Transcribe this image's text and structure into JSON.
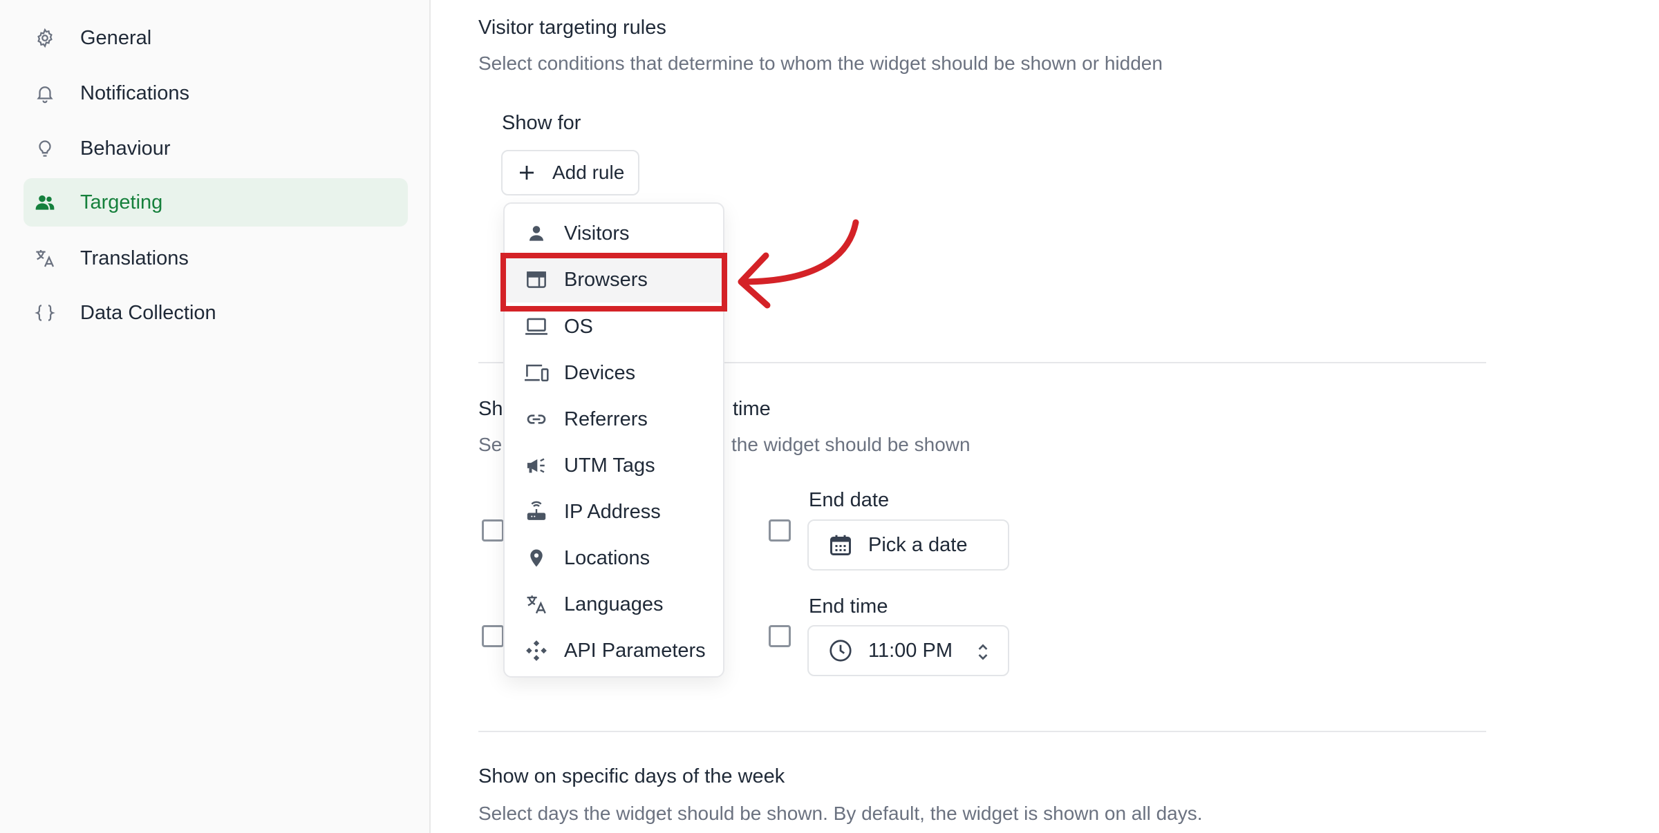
{
  "sidebar": {
    "items": [
      {
        "label": "General",
        "icon": "gear-icon"
      },
      {
        "label": "Notifications",
        "icon": "bell-icon"
      },
      {
        "label": "Behaviour",
        "icon": "lightbulb-icon"
      },
      {
        "label": "Targeting",
        "icon": "users-icon",
        "active": true
      },
      {
        "label": "Translations",
        "icon": "translate-icon"
      },
      {
        "label": "Data Collection",
        "icon": "braces-icon"
      }
    ]
  },
  "visitor_targeting": {
    "title": "Visitor targeting rules",
    "description": "Select conditions that determine to whom the widget should be shown or hidden",
    "show_for_label": "Show for",
    "add_rule_label": "Add rule"
  },
  "rule_menu": {
    "items": [
      {
        "label": "Visitors",
        "icon": "person-icon"
      },
      {
        "label": "Browsers",
        "icon": "browser-window-icon",
        "highlighted": true
      },
      {
        "label": "OS",
        "icon": "laptop-icon"
      },
      {
        "label": "Devices",
        "icon": "devices-icon"
      },
      {
        "label": "Referrers",
        "icon": "link-icon"
      },
      {
        "label": "UTM Tags",
        "icon": "megaphone-icon"
      },
      {
        "label": "IP Address",
        "icon": "router-icon"
      },
      {
        "label": "Locations",
        "icon": "location-pin-icon"
      },
      {
        "label": "Languages",
        "icon": "translate-icon"
      },
      {
        "label": "API Parameters",
        "icon": "api-icon"
      }
    ]
  },
  "schedule": {
    "title_visible_prefix": "Sh",
    "title_visible_suffix": "time",
    "desc_visible_prefix": "Se",
    "desc_visible_suffix": "the widget should be shown",
    "end_date_label": "End date",
    "end_date_placeholder": "Pick a date",
    "end_time_label": "End time",
    "end_time_value": "11:00 PM"
  },
  "days_of_week": {
    "title": "Show on specific days of the week",
    "description": "Select days the widget should be shown. By default, the widget is shown on all days."
  },
  "colors": {
    "accent_green": "#16803c",
    "active_bg": "#e9f3ec",
    "highlight_red": "#d42227"
  }
}
